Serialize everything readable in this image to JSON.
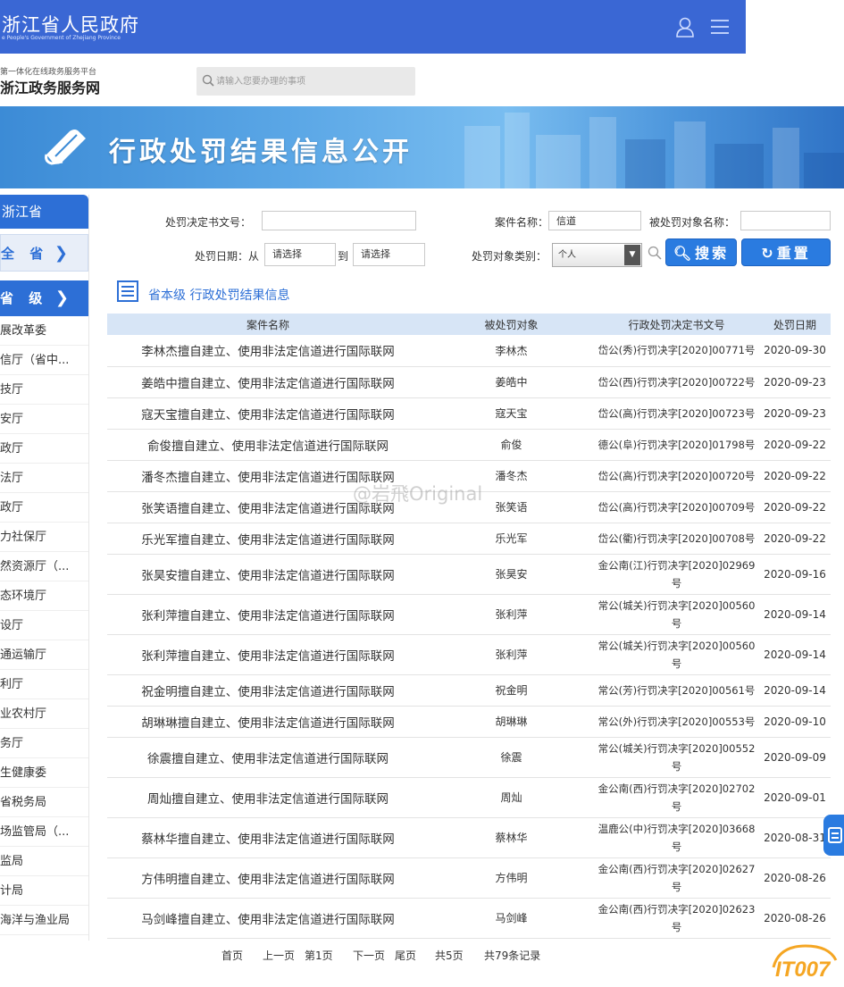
{
  "header": {
    "gov_title": "浙江省人民政府",
    "gov_subtitle": "e People's Government of Zhejiang Province",
    "brand_small": "第一体化在线政务服务平台",
    "brand_big": "浙江政务服务网",
    "search_placeholder": "请输入您要办理的事项"
  },
  "banner": {
    "title": "行政处罚结果信息公开"
  },
  "sidebar": {
    "province": "浙江省",
    "all": "全 省",
    "level": "省 级",
    "items": [
      "展改革委",
      "信厅（省中...",
      "技厅",
      "安厅",
      "政厅",
      "法厅",
      "政厅",
      "力社保厅",
      "然资源厅（...",
      "态环境厅",
      "设厅",
      "通运输厅",
      "利厅",
      "业农村厅",
      "务厅",
      "生健康委",
      "省税务局",
      "场监管局（...",
      "监局",
      "计局",
      "海洋与渔业局"
    ]
  },
  "filters": {
    "decision_no_label": "处罚决定书文号：",
    "decision_no_value": "",
    "case_name_label": "案件名称：",
    "case_name_value": "信道",
    "target_name_label": "被处罚对象名称：",
    "target_name_value": "",
    "date_label": "处罚日期：从",
    "date_from": "请选择",
    "date_to_label": "到",
    "date_to": "请选择",
    "target_type_label": "处罚对象类别：",
    "target_type_value": "个人",
    "search_button": "搜索",
    "reset_button": "重置"
  },
  "section": {
    "title": "省本级 行政处罚结果信息"
  },
  "table": {
    "headers": [
      "案件名称",
      "被处罚对象",
      "行政处罚决定书文号",
      "处罚日期"
    ],
    "rows": [
      {
        "case": "李林杰擅自建立、使用非法定信道进行国际联网",
        "target": "李林杰",
        "doc": "岱公(秀)行罚决字[2020]00771号",
        "date": "2020-09-30",
        "tall": false
      },
      {
        "case": "姜皓中擅自建立、使用非法定信道进行国际联网",
        "target": "姜皓中",
        "doc": "岱公(西)行罚决字[2020]00722号",
        "date": "2020-09-23",
        "tall": false
      },
      {
        "case": "寇天宝擅自建立、使用非法定信道进行国际联网",
        "target": "寇天宝",
        "doc": "岱公(高)行罚决字[2020]00723号",
        "date": "2020-09-23",
        "tall": false
      },
      {
        "case": "俞俊擅自建立、使用非法定信道进行国际联网",
        "target": "俞俊",
        "doc": "德公(阜)行罚决字[2020]01798号",
        "date": "2020-09-22",
        "tall": false
      },
      {
        "case": "潘冬杰擅自建立、使用非法定信道进行国际联网",
        "target": "潘冬杰",
        "doc": "岱公(高)行罚决字[2020]00720号",
        "date": "2020-09-22",
        "tall": false
      },
      {
        "case": "张笑语擅自建立、使用非法定信道进行国际联网",
        "target": "张笑语",
        "doc": "岱公(高)行罚决字[2020]00709号",
        "date": "2020-09-22",
        "tall": false
      },
      {
        "case": "乐光军擅自建立、使用非法定信道进行国际联网",
        "target": "乐光军",
        "doc": "岱公(衢)行罚决字[2020]00708号",
        "date": "2020-09-22",
        "tall": false
      },
      {
        "case": "张昊安擅自建立、使用非法定信道进行国际联网",
        "target": "张昊安",
        "doc": "金公南(江)行罚决字[2020]02969号",
        "date": "2020-09-16",
        "tall": true
      },
      {
        "case": "张利萍擅自建立、使用非法定信道进行国际联网",
        "target": "张利萍",
        "doc": "常公(城关)行罚决字[2020]00560号",
        "date": "2020-09-14",
        "tall": true
      },
      {
        "case": "张利萍擅自建立、使用非法定信道进行国际联网",
        "target": "张利萍",
        "doc": "常公(城关)行罚决字[2020]00560号",
        "date": "2020-09-14",
        "tall": true
      },
      {
        "case": "祝金明擅自建立、使用非法定信道进行国际联网",
        "target": "祝金明",
        "doc": "常公(芳)行罚决字[2020]00561号",
        "date": "2020-09-14",
        "tall": false
      },
      {
        "case": "胡琳琳擅自建立、使用非法定信道进行国际联网",
        "target": "胡琳琳",
        "doc": "常公(外)行罚决字[2020]00553号",
        "date": "2020-09-10",
        "tall": false
      },
      {
        "case": "徐震擅自建立、使用非法定信道进行国际联网",
        "target": "徐震",
        "doc": "常公(城关)行罚决字[2020]00552号",
        "date": "2020-09-09",
        "tall": true
      },
      {
        "case": "周灿擅自建立、使用非法定信道进行国际联网",
        "target": "周灿",
        "doc": "金公南(西)行罚决字[2020]02702号",
        "date": "2020-09-01",
        "tall": true
      },
      {
        "case": "蔡林华擅自建立、使用非法定信道进行国际联网",
        "target": "蔡林华",
        "doc": "温鹿公(中)行罚决字[2020]03668号",
        "date": "2020-08-31",
        "tall": true
      },
      {
        "case": "方伟明擅自建立、使用非法定信道进行国际联网",
        "target": "方伟明",
        "doc": "金公南(西)行罚决字[2020]02627号",
        "date": "2020-08-26",
        "tall": true
      },
      {
        "case": "马剑峰擅自建立、使用非法定信道进行国际联网",
        "target": "马剑峰",
        "doc": "金公南(西)行罚决字[2020]02623号",
        "date": "2020-08-26",
        "tall": true
      }
    ]
  },
  "pager": {
    "first": "首页",
    "prev": "上一页",
    "current": "第1页",
    "next": "下一页",
    "last": "尾页",
    "total_pages": "共5页",
    "total_records": "共79条记录"
  },
  "watermark": {
    "text": "@岩飛Original",
    "logo": "IT007"
  },
  "colors": {
    "header_blue": "#3a67d4",
    "accent_blue": "#2d6fd6",
    "button_blue": "#2a7be0",
    "table_header": "#d7e5f6"
  }
}
